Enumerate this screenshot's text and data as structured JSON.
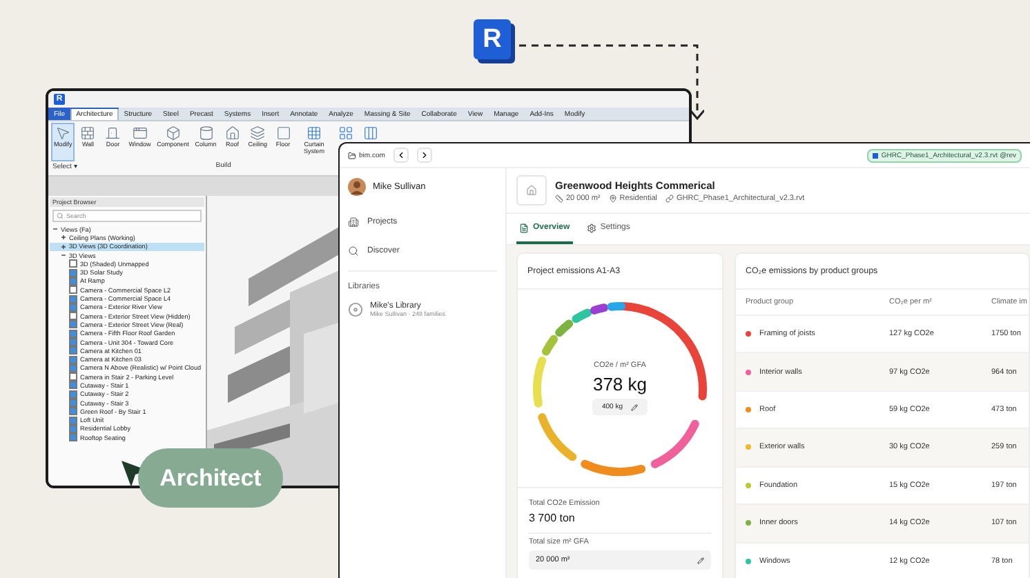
{
  "logo": {
    "letter": "R"
  },
  "revit": {
    "app_letter": "R",
    "tabs": [
      {
        "label": "File",
        "kind": "file"
      },
      {
        "label": "Architecture",
        "kind": "tab",
        "selected": true
      },
      {
        "label": "Structure",
        "kind": "tab",
        "selected": false
      },
      {
        "label": "Steel",
        "kind": "tab",
        "selected": false
      },
      {
        "label": "Precast",
        "kind": "tab",
        "selected": false
      },
      {
        "label": "Systems",
        "kind": "tab",
        "selected": false
      },
      {
        "label": "Insert",
        "kind": "tab",
        "selected": false
      },
      {
        "label": "Annotate",
        "kind": "tab",
        "selected": false
      },
      {
        "label": "Analyze",
        "kind": "tab",
        "selected": false
      },
      {
        "label": "Massing & Site",
        "kind": "tab",
        "selected": false
      },
      {
        "label": "Collaborate",
        "kind": "tab",
        "selected": false
      },
      {
        "label": "View",
        "kind": "tab",
        "selected": false
      },
      {
        "label": "Manage",
        "kind": "tab",
        "selected": false
      },
      {
        "label": "Add-Ins",
        "kind": "tab",
        "selected": false
      },
      {
        "label": "Modify",
        "kind": "tab",
        "selected": false
      }
    ],
    "tools": [
      {
        "label": "Modify",
        "kind": "pointer",
        "selected": true
      },
      {
        "label": "Wall",
        "kind": "wall",
        "selected": false
      },
      {
        "label": "Door",
        "kind": "door",
        "selected": false
      },
      {
        "label": "Window",
        "kind": "window",
        "selected": false
      },
      {
        "label": "Component",
        "kind": "component",
        "selected": false
      },
      {
        "label": "Column",
        "kind": "column",
        "selected": false
      },
      {
        "label": "Roof",
        "kind": "roof",
        "selected": false
      },
      {
        "label": "Ceiling",
        "kind": "ceiling",
        "selected": false
      },
      {
        "label": "Floor",
        "kind": "floor",
        "selected": false
      },
      {
        "label": "Curtain System",
        "kind": "curtain",
        "selected": false
      },
      {
        "kind": "grid",
        "selected": false
      },
      {
        "kind": "mullion",
        "selected": false
      }
    ],
    "groups": [
      "Select ▾",
      "Build"
    ],
    "browser": {
      "title": "Project Browser",
      "search_placeholder": "Search",
      "tree": [
        {
          "label": "Views (Fa)",
          "expanded": true,
          "selected": false,
          "children": [
            {
              "label": "Ceiling Plans (Working)",
              "expanded": false,
              "selected": false
            },
            {
              "label": "3D Views (3D Coordination)",
              "expanded": false,
              "selected": true
            },
            {
              "label": "3D Views",
              "expanded": true,
              "selected": false,
              "children": [
                {
                  "label": "3D (Shaded) Unmapped",
                  "checked": false
                },
                {
                  "label": "3D Solar Study",
                  "checked": true
                },
                {
                  "label": "At Ramp",
                  "checked": true
                },
                {
                  "label": "Camera - Commercial Space L2",
                  "checked": false
                },
                {
                  "label": "Camera - Commercial Space L4",
                  "checked": true
                },
                {
                  "label": "Camera - Exterior River View",
                  "checked": true
                },
                {
                  "label": "Camera - Exterior Street View (Hidden)",
                  "checked": false
                },
                {
                  "label": "Camera - Exterior Street View (Real)",
                  "checked": true
                },
                {
                  "label": "Camera - Fifth Floor Roof Garden",
                  "checked": true
                },
                {
                  "label": "Camera - Unit 304 - Toward Core",
                  "checked": true
                },
                {
                  "label": "Camera at Kitchen 01",
                  "checked": true
                },
                {
                  "label": "Camera at Kitchen 03",
                  "checked": true
                },
                {
                  "label": "Camera N Above (Realistic) w/ Point Cloud",
                  "checked": true
                },
                {
                  "label": "Camera in Stair 2 - Parking Level",
                  "checked": false
                },
                {
                  "label": "Cutaway - Stair 1",
                  "checked": true
                },
                {
                  "label": "Cutaway - Stair 2",
                  "checked": true
                },
                {
                  "label": "Cutaway - Stair 3",
                  "checked": true
                },
                {
                  "label": "Green Roof - By Stair 1",
                  "checked": true
                },
                {
                  "label": "Loft Unit",
                  "checked": true
                },
                {
                  "label": "Residential Lobby",
                  "checked": true
                },
                {
                  "label": "Rooftop Seating",
                  "checked": true
                }
              ]
            }
          ]
        }
      ]
    }
  },
  "badge": {
    "label": "Architect"
  },
  "web": {
    "url": "bim.com",
    "file_pill": "GHRC_Phase1_Architectural_v2.3.rvt @rev",
    "user": "Mike Sullivan",
    "nav": [
      {
        "label": "Projects",
        "kind": "projects"
      },
      {
        "label": "Discover",
        "kind": "discover"
      }
    ],
    "libraries_heading": "Libraries",
    "library": {
      "name": "Mike's Library",
      "meta": "Mike Sullivan · 248 families"
    },
    "project": {
      "title": "Greenwood Heights Commerical",
      "area": "20 000 m²",
      "type": "Residential",
      "file": "GHRC_Phase1_Architectural_v2.3.rvt"
    },
    "tabs": [
      {
        "label": "Overview",
        "kind": "overview",
        "selected": true
      },
      {
        "label": "Settings",
        "kind": "settings",
        "selected": false
      }
    ],
    "emissions": {
      "title": "Project emissions A1-A3",
      "center_label": "CO2e / m² GFA",
      "center_value": "378 kg",
      "target": "400 kg",
      "total_label": "Total CO2e Emission",
      "total_value": "3 700 ton",
      "size_label": "Total size m² GFA",
      "size_value": "20 000 m²"
    },
    "groups": {
      "title": "CO₂e emissions by product groups",
      "columns": [
        "Product group",
        "CO₂e per m²",
        "Climate im"
      ],
      "rows": [
        {
          "name": "Framing of joists",
          "color": "#e8443a",
          "per_m2": "127 kg CO2e",
          "climate": "1750 ton"
        },
        {
          "name": "Interior walls",
          "color": "#f0609a",
          "per_m2": "97 kg CO2e",
          "climate": "964 ton"
        },
        {
          "name": "Roof",
          "color": "#f08c1e",
          "per_m2": "59 kg CO2e",
          "climate": "473 ton"
        },
        {
          "name": "Exterior walls",
          "color": "#f0b82a",
          "per_m2": "30 kg CO2e",
          "climate": "259 ton"
        },
        {
          "name": "Foundation",
          "color": "#b8cc30",
          "per_m2": "15 kg CO2e",
          "climate": "197 ton"
        },
        {
          "name": "Inner doors",
          "color": "#7cb342",
          "per_m2": "14 kg CO2e",
          "climate": "107 ton"
        },
        {
          "name": "Windows",
          "color": "#2ec4a0",
          "per_m2": "12 kg CO2e",
          "climate": "78 ton"
        }
      ]
    }
  }
}
